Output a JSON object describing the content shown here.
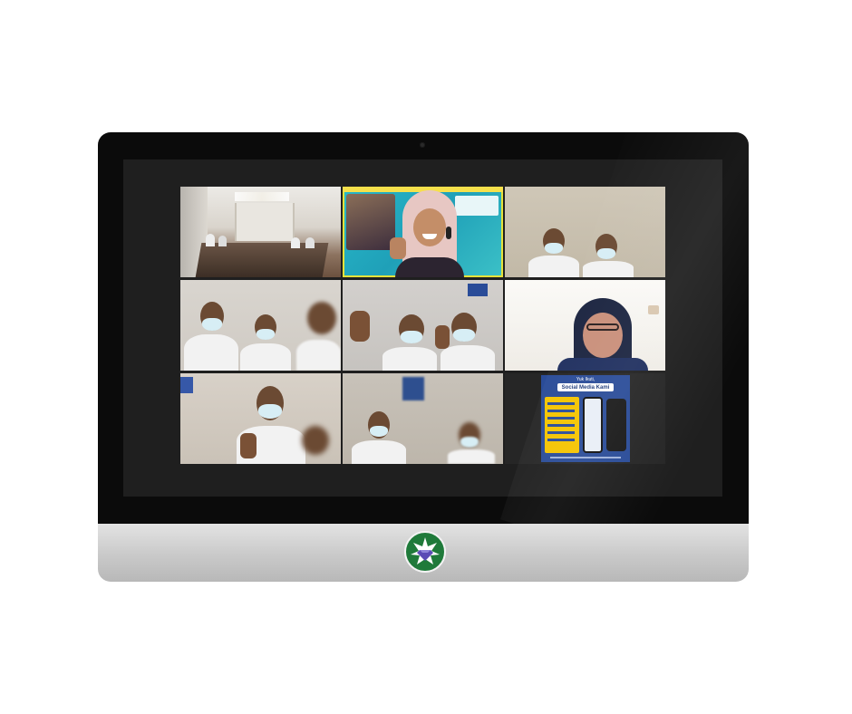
{
  "colors": {
    "bezel": "#0b0b0b",
    "screen": "#1f1f1f",
    "chassis": "#c9c9c9",
    "active_speaker_border": "#e6e23a",
    "logo_green": "#1f7a3a",
    "poster_blue": "#2a4c98",
    "poster_yellow": "#f5c400"
  },
  "tiles": [
    {
      "id": "meeting-room",
      "description_icon": "conference-room-icon"
    },
    {
      "id": "host-presenter",
      "active": true
    },
    {
      "id": "two-students-1"
    },
    {
      "id": "three-students"
    },
    {
      "id": "two-students-thumbs-up"
    },
    {
      "id": "woman-glasses"
    },
    {
      "id": "one-student-thumbs-up"
    },
    {
      "id": "students-blurred"
    },
    {
      "id": "shared-poster"
    }
  ],
  "poster": {
    "heading": "Yuk Ikuti,",
    "title": "Social Media Kami"
  },
  "logo_icon": "diamond-star-emblem-icon"
}
